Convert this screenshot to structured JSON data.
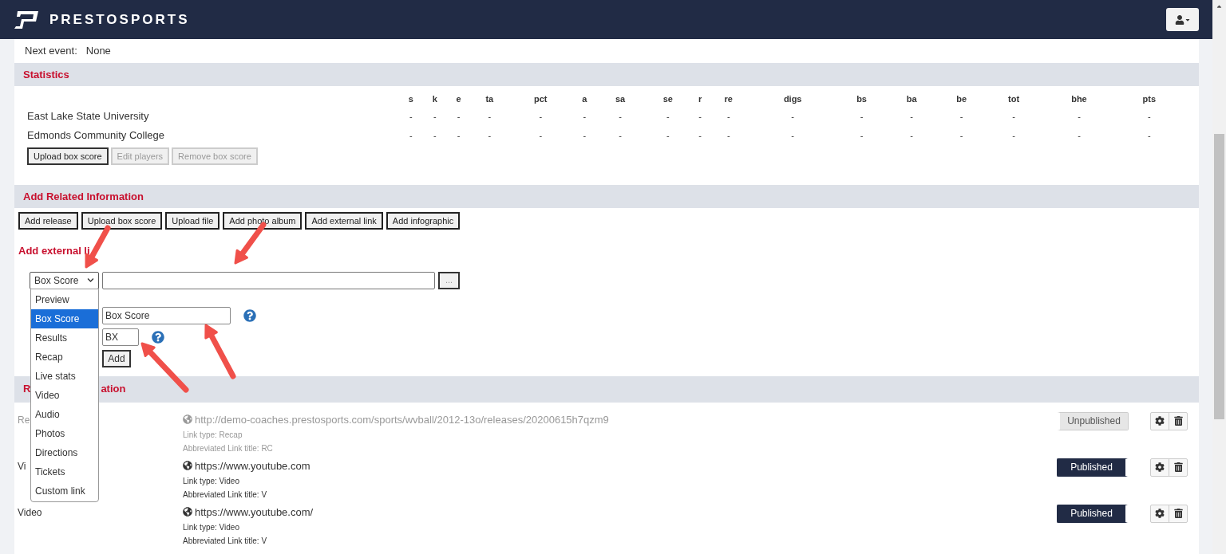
{
  "header": {
    "logo_text": "PRESTOSPORTS"
  },
  "next_event": {
    "label": "Next event:",
    "value": "None"
  },
  "statistics": {
    "title": "Statistics",
    "columns": [
      "s",
      "k",
      "e",
      "ta",
      "pct",
      "a",
      "sa",
      "se",
      "r",
      "re",
      "digs",
      "bs",
      "ba",
      "be",
      "tot",
      "bhe",
      "pts"
    ],
    "rows": [
      {
        "team": "East Lake State University",
        "values": [
          "-",
          "-",
          "-",
          "-",
          "-",
          "-",
          "-",
          "-",
          "-",
          "-",
          "-",
          "-",
          "-",
          "-",
          "-",
          "-",
          "-"
        ]
      },
      {
        "team": "Edmonds Community College",
        "values": [
          "-",
          "-",
          "-",
          "-",
          "-",
          "-",
          "-",
          "-",
          "-",
          "-",
          "-",
          "-",
          "-",
          "-",
          "-",
          "-",
          "-"
        ]
      }
    ],
    "buttons": [
      {
        "label": "Upload box score",
        "disabled": false
      },
      {
        "label": "Edit players",
        "disabled": true
      },
      {
        "label": "Remove box score",
        "disabled": true
      }
    ]
  },
  "add_related": {
    "title": "Add Related Information",
    "buttons": [
      "Add release",
      "Upload box score",
      "Upload file",
      "Add photo album",
      "Add external link",
      "Add infographic"
    ]
  },
  "external_link": {
    "title": "Add external li",
    "type_select": {
      "value": "Box Score",
      "expanded": true
    },
    "browse_button": "...",
    "title_field": {
      "value": "Box Score"
    },
    "abbrev_field": {
      "value": "BX"
    },
    "add_button": "Add",
    "options": [
      {
        "label": "Preview",
        "selected": false
      },
      {
        "label": "Box Score",
        "selected": true
      },
      {
        "label": "Results",
        "selected": false
      },
      {
        "label": "Recap",
        "selected": false
      },
      {
        "label": "Live stats",
        "selected": false
      },
      {
        "label": "Video",
        "selected": false
      },
      {
        "label": "Audio",
        "selected": false
      },
      {
        "label": "Photos",
        "selected": false
      },
      {
        "label": "Directions",
        "selected": false
      },
      {
        "label": "Tickets",
        "selected": false
      },
      {
        "label": "Custom link",
        "selected": false
      }
    ]
  },
  "related_info": {
    "title_parts": [
      "R",
      "ation"
    ],
    "items": [
      {
        "label": "Re",
        "url": "http://demo-coaches.prestosports.com/sports/wvball/2012-13o/releases/20200615h7qzm9",
        "link_type": "Link type: Recap",
        "abbrev": "Abbreviated Link title: RC",
        "published": false,
        "status": "Unpublished"
      },
      {
        "label": "Vi",
        "url": "https://www.youtube.com",
        "link_type": "Link type: Video",
        "abbrev": "Abbreviated Link title: V",
        "published": true,
        "status": "Published"
      },
      {
        "label": "Video",
        "url": "https://www.youtube.com/",
        "link_type": "Link type: Video",
        "abbrev": "Abbreviated Link title: V",
        "published": true,
        "status": "Published"
      }
    ]
  }
}
